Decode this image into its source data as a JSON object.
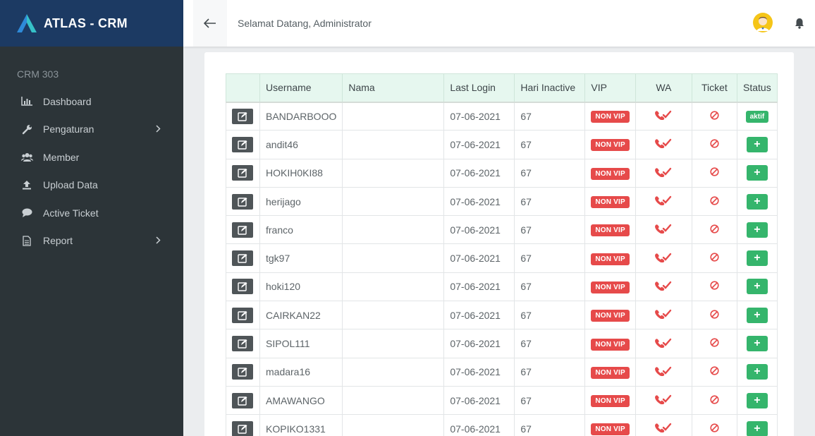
{
  "brand": {
    "title": "ATLAS - CRM"
  },
  "sidebar": {
    "section": "CRM 303",
    "items": [
      {
        "label": "Dashboard",
        "icon": "bar-chart-icon"
      },
      {
        "label": "Pengaturan",
        "icon": "wrench-icon",
        "has_submenu": true
      },
      {
        "label": "Member",
        "icon": "users-icon"
      },
      {
        "label": "Upload Data",
        "icon": "upload-icon"
      },
      {
        "label": "Active Ticket",
        "icon": "chat-icon"
      },
      {
        "label": "Report",
        "icon": "document-icon",
        "has_submenu": true
      }
    ]
  },
  "header": {
    "welcome": "Selamat Datang, Administrator"
  },
  "table": {
    "columns": [
      "",
      "Username",
      "Nama",
      "Last Login",
      "Hari Inactive",
      "VIP",
      "WA",
      "Ticket",
      "Status"
    ],
    "rows": [
      {
        "username": "BANDARBOOO",
        "nama": "",
        "last_login": "07-06-2021",
        "inactive": "67",
        "vip": "NON VIP",
        "status": "aktif"
      },
      {
        "username": "andit46",
        "nama": "",
        "last_login": "07-06-2021",
        "inactive": "67",
        "vip": "NON VIP",
        "status": "+"
      },
      {
        "username": "HOKIH0KI88",
        "nama": "",
        "last_login": "07-06-2021",
        "inactive": "67",
        "vip": "NON VIP",
        "status": "+"
      },
      {
        "username": "herijago",
        "nama": "",
        "last_login": "07-06-2021",
        "inactive": "67",
        "vip": "NON VIP",
        "status": "+"
      },
      {
        "username": "franco",
        "nama": "",
        "last_login": "07-06-2021",
        "inactive": "67",
        "vip": "NON VIP",
        "status": "+"
      },
      {
        "username": "tgk97",
        "nama": "",
        "last_login": "07-06-2021",
        "inactive": "67",
        "vip": "NON VIP",
        "status": "+"
      },
      {
        "username": "hoki120",
        "nama": "",
        "last_login": "07-06-2021",
        "inactive": "67",
        "vip": "NON VIP",
        "status": "+"
      },
      {
        "username": "CAIRKAN22",
        "nama": "",
        "last_login": "07-06-2021",
        "inactive": "67",
        "vip": "NON VIP",
        "status": "+"
      },
      {
        "username": "SIPOL111",
        "nama": "",
        "last_login": "07-06-2021",
        "inactive": "67",
        "vip": "NON VIP",
        "status": "+"
      },
      {
        "username": "madara16",
        "nama": "",
        "last_login": "07-06-2021",
        "inactive": "67",
        "vip": "NON VIP",
        "status": "+"
      },
      {
        "username": "AMAWANGO",
        "nama": "",
        "last_login": "07-06-2021",
        "inactive": "67",
        "vip": "NON VIP",
        "status": "+"
      },
      {
        "username": "KOPIKO1331",
        "nama": "",
        "last_login": "07-06-2021",
        "inactive": "67",
        "vip": "NON VIP",
        "status": "+"
      }
    ]
  },
  "colors": {
    "sidebar_bg": "#2c3438",
    "brand_bg": "#1c3a63",
    "header_row_bg": "#e6f7ef",
    "vip_badge": "#e64a4a",
    "status_green": "#35b56c",
    "icon_red": "#e64a4a"
  }
}
